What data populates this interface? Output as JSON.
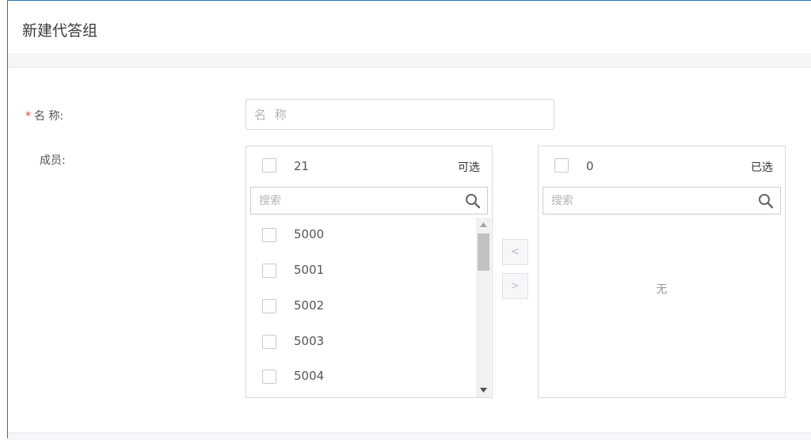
{
  "dialog": {
    "title": "新建代答组"
  },
  "form": {
    "name": {
      "required_mark": "*",
      "label": "名 称:",
      "placeholder": "名 称",
      "value": ""
    },
    "members": {
      "label": "成员:"
    }
  },
  "available": {
    "count": "21",
    "tag": "可选",
    "search_placeholder": "搜索",
    "items": [
      "5000",
      "5001",
      "5002",
      "5003",
      "5004"
    ]
  },
  "selected": {
    "count": "0",
    "tag": "已选",
    "search_placeholder": "搜索",
    "empty_text": "无"
  },
  "transfer": {
    "left_symbol": "<",
    "right_symbol": ">"
  },
  "colors": {
    "frame_border": "#2f6fb6",
    "required": "#e0403a",
    "band": "#f4f6f8"
  }
}
